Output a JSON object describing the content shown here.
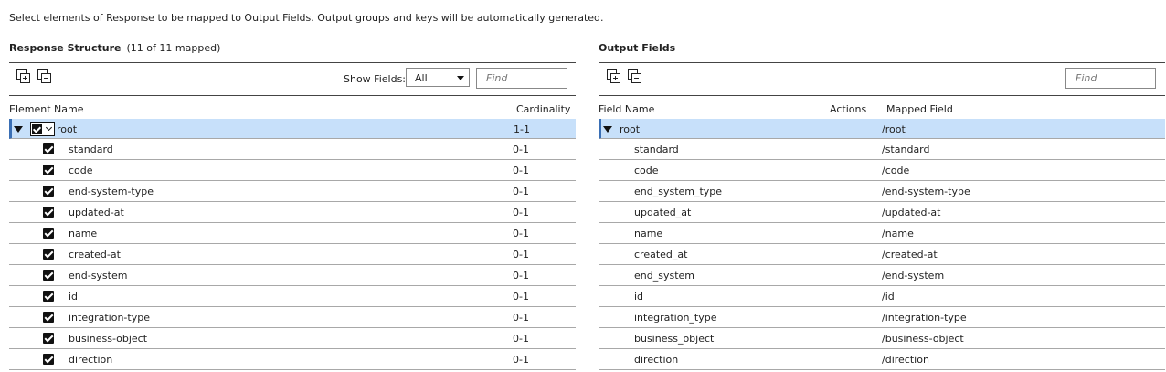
{
  "intro_text": "Select elements of Response to be mapped to Output Fields. Output groups and keys will be automatically generated.",
  "left": {
    "title": "Response Structure",
    "mapped_count": "(11 of 11 mapped)",
    "show_fields_label": "Show Fields:",
    "show_fields_value": "All",
    "find_placeholder": "Find",
    "col_element": "Element Name",
    "col_cardinality": "Cardinality",
    "root": {
      "name": "root",
      "cardinality": "1-1"
    },
    "rows": [
      {
        "name": "standard",
        "cardinality": "0-1"
      },
      {
        "name": "code",
        "cardinality": "0-1"
      },
      {
        "name": "end-system-type",
        "cardinality": "0-1"
      },
      {
        "name": "updated-at",
        "cardinality": "0-1"
      },
      {
        "name": "name",
        "cardinality": "0-1"
      },
      {
        "name": "created-at",
        "cardinality": "0-1"
      },
      {
        "name": "end-system",
        "cardinality": "0-1"
      },
      {
        "name": "id",
        "cardinality": "0-1"
      },
      {
        "name": "integration-type",
        "cardinality": "0-1"
      },
      {
        "name": "business-object",
        "cardinality": "0-1"
      },
      {
        "name": "direction",
        "cardinality": "0-1"
      }
    ]
  },
  "right": {
    "title": "Output Fields",
    "find_placeholder": "Find",
    "col_field": "Field Name",
    "col_actions": "Actions",
    "col_mapped": "Mapped Field",
    "root": {
      "name": "root",
      "mapped": "/root"
    },
    "rows": [
      {
        "name": "standard",
        "mapped": "/standard"
      },
      {
        "name": "code",
        "mapped": "/code"
      },
      {
        "name": "end_system_type",
        "mapped": "/end-system-type"
      },
      {
        "name": "updated_at",
        "mapped": "/updated-at"
      },
      {
        "name": "name",
        "mapped": "/name"
      },
      {
        "name": "created_at",
        "mapped": "/created-at"
      },
      {
        "name": "end_system",
        "mapped": "/end-system"
      },
      {
        "name": "id",
        "mapped": "/id"
      },
      {
        "name": "integration_type",
        "mapped": "/integration-type"
      },
      {
        "name": "business_object",
        "mapped": "/business-object"
      },
      {
        "name": "direction",
        "mapped": "/direction"
      }
    ]
  },
  "icons": {
    "expand": "expand-all-icon",
    "collapse": "collapse-all-icon"
  }
}
